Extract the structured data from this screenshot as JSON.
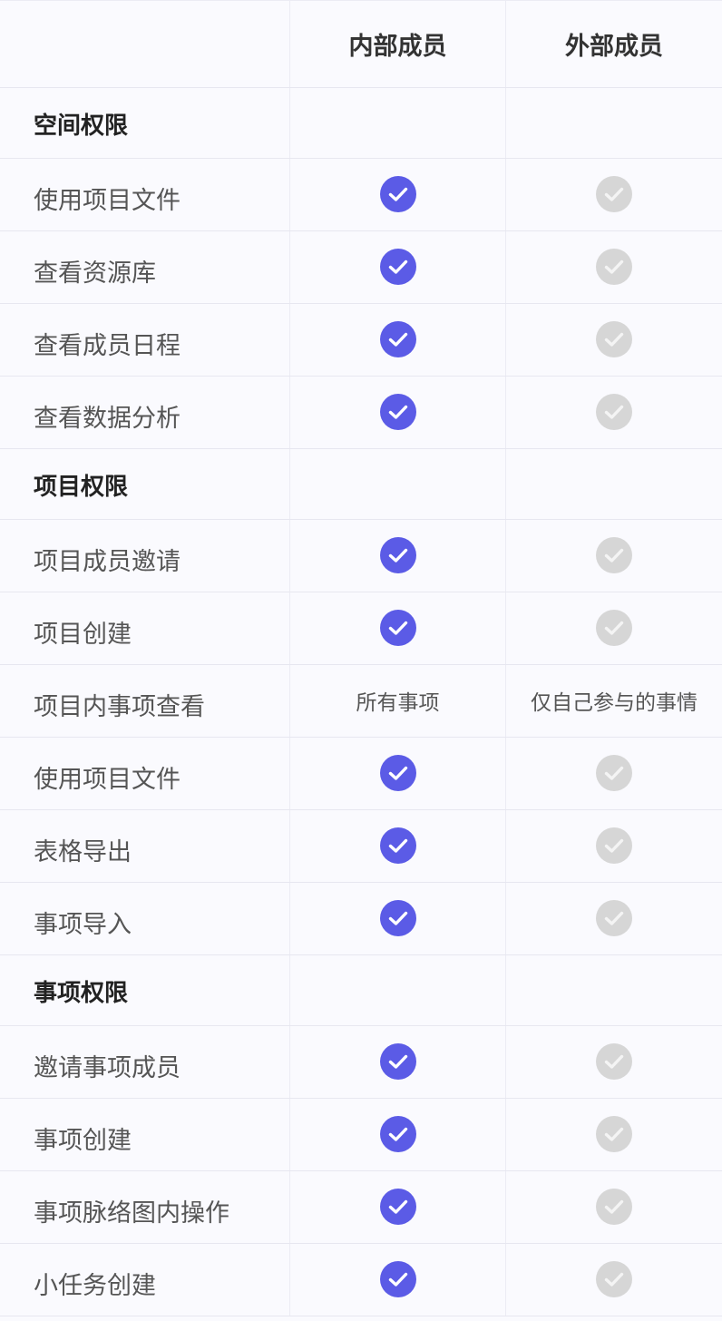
{
  "header": {
    "col_blank": "",
    "col_internal": "内部成员",
    "col_external": "外部成员"
  },
  "colors": {
    "check_enabled": "#5b5be6",
    "check_disabled": "#d6d6d6",
    "check_mark_enabled": "#ffffff",
    "check_mark_disabled": "#f4f4f4"
  },
  "sections": [
    {
      "title": "空间权限",
      "rows": [
        {
          "label": "使用项目文件",
          "internal": "check-enabled",
          "external": "check-disabled"
        },
        {
          "label": "查看资源库",
          "internal": "check-enabled",
          "external": "check-disabled"
        },
        {
          "label": "查看成员日程",
          "internal": "check-enabled",
          "external": "check-disabled"
        },
        {
          "label": "查看数据分析",
          "internal": "check-enabled",
          "external": "check-disabled"
        }
      ]
    },
    {
      "title": "项目权限",
      "rows": [
        {
          "label": "项目成员邀请",
          "internal": "check-enabled",
          "external": "check-disabled"
        },
        {
          "label": "项目创建",
          "internal": "check-enabled",
          "external": "check-disabled"
        },
        {
          "label": "项目内事项查看",
          "internal_text": "所有事项",
          "external_text": "仅自己参与的事情"
        },
        {
          "label": "使用项目文件",
          "internal": "check-enabled",
          "external": "check-disabled"
        },
        {
          "label": "表格导出",
          "internal": "check-enabled",
          "external": "check-disabled"
        },
        {
          "label": "事项导入",
          "internal": "check-enabled",
          "external": "check-disabled"
        }
      ]
    },
    {
      "title": "事项权限",
      "rows": [
        {
          "label": "邀请事项成员",
          "internal": "check-enabled",
          "external": "check-disabled"
        },
        {
          "label": "事项创建",
          "internal": "check-enabled",
          "external": "check-disabled"
        },
        {
          "label": "事项脉络图内操作",
          "internal": "check-enabled",
          "external": "check-disabled"
        },
        {
          "label": "小任务创建",
          "internal": "check-enabled",
          "external": "check-disabled"
        }
      ]
    }
  ]
}
